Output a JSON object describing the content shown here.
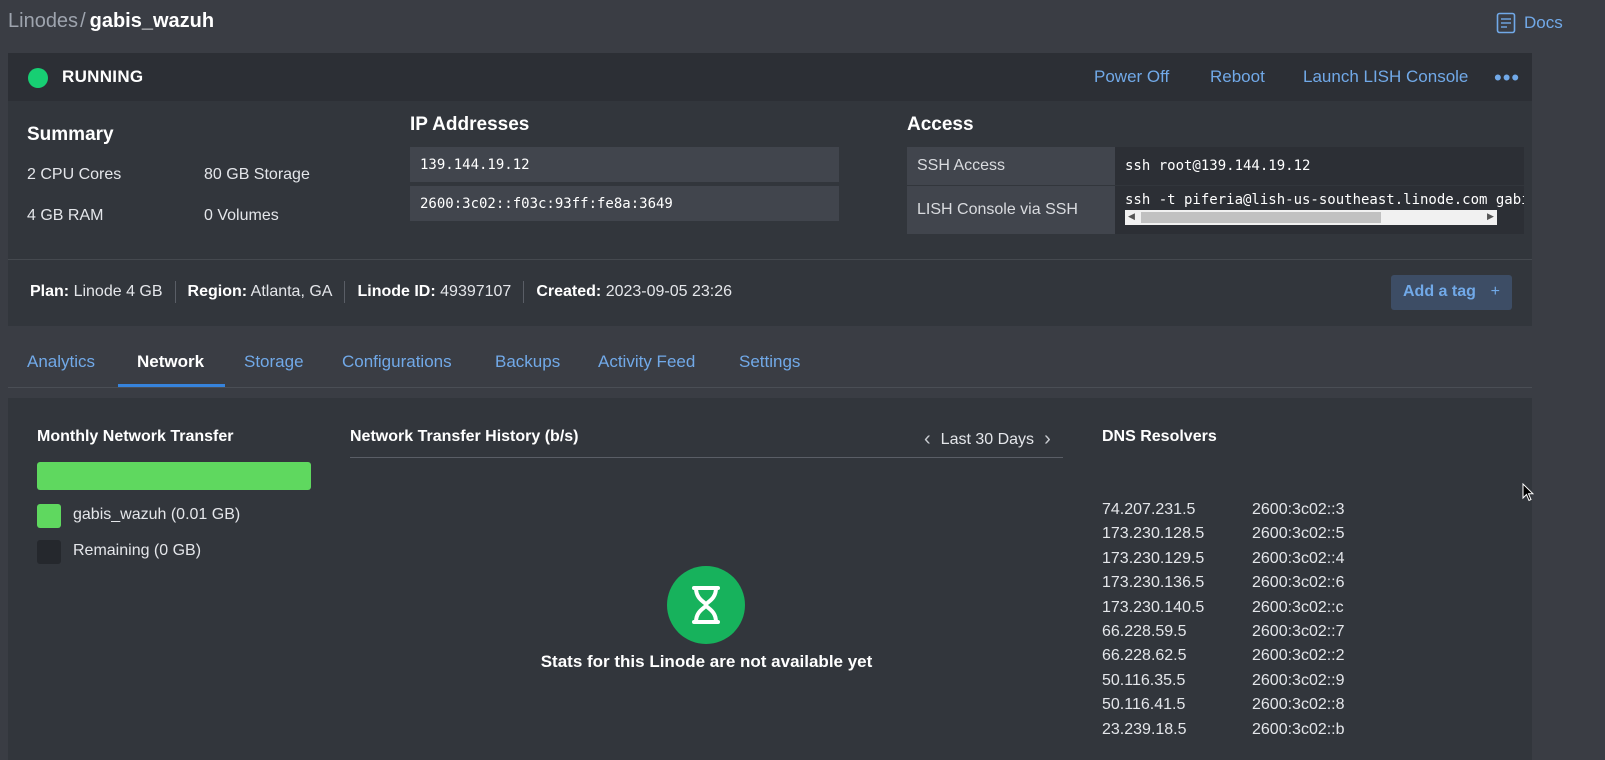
{
  "breadcrumb": {
    "parent": "Linodes",
    "separator": "/",
    "current": "gabis_wazuh"
  },
  "docs_label": "Docs",
  "status": {
    "label": "RUNNING",
    "color": "#17cf73",
    "actions": [
      "Power Off",
      "Reboot",
      "Launch LISH Console"
    ]
  },
  "summary": {
    "title": "Summary",
    "cpu": "2 CPU Cores",
    "storage": "80 GB Storage",
    "ram": "4 GB RAM",
    "volumes": "0 Volumes"
  },
  "ip": {
    "title": "IP Addresses",
    "addresses": [
      "139.144.19.12",
      "2600:3c02::f03c:93ff:fe8a:3649"
    ]
  },
  "access": {
    "title": "Access",
    "rows": [
      {
        "label": "SSH Access",
        "value": "ssh root@139.144.19.12"
      },
      {
        "label": "LISH Console via SSH",
        "value": "ssh -t piferia@lish-us-southeast.linode.com gabis_wazuh"
      }
    ]
  },
  "meta": {
    "plan_label": "Plan:",
    "plan": "Linode 4 GB",
    "region_label": "Region:",
    "region": "Atlanta, GA",
    "id_label": "Linode ID:",
    "id": "49397107",
    "created_label": "Created:",
    "created": "2023-09-05 23:26"
  },
  "tag_button": {
    "label": "Add a tag",
    "icon": "+"
  },
  "tabs": [
    "Analytics",
    "Network",
    "Storage",
    "Configurations",
    "Backups",
    "Activity Feed",
    "Settings"
  ],
  "active_tab": "Network",
  "network": {
    "monthly_title": "Monthly Network Transfer",
    "used_fraction": 1.0,
    "legend": [
      {
        "label": "gabis_wazuh (0.01 GB)",
        "color": "#5fd85f"
      },
      {
        "label": "Remaining (0 GB)",
        "color": "#25282d"
      }
    ],
    "history_title": "Network Transfer History (b/s)",
    "range_label": "Last 30 Days",
    "empty_message": "Stats for this Linode are not available yet",
    "dns_title": "DNS Resolvers",
    "dns_v4": [
      "74.207.231.5",
      "173.230.128.5",
      "173.230.129.5",
      "173.230.136.5",
      "173.230.140.5",
      "66.228.59.5",
      "66.228.62.5",
      "50.116.35.5",
      "50.116.41.5",
      "23.239.18.5"
    ],
    "dns_v6": [
      "2600:3c02::3",
      "2600:3c02::5",
      "2600:3c02::4",
      "2600:3c02::6",
      "2600:3c02::c",
      "2600:3c02::7",
      "2600:3c02::2",
      "2600:3c02::9",
      "2600:3c02::8",
      "2600:3c02::b"
    ]
  }
}
